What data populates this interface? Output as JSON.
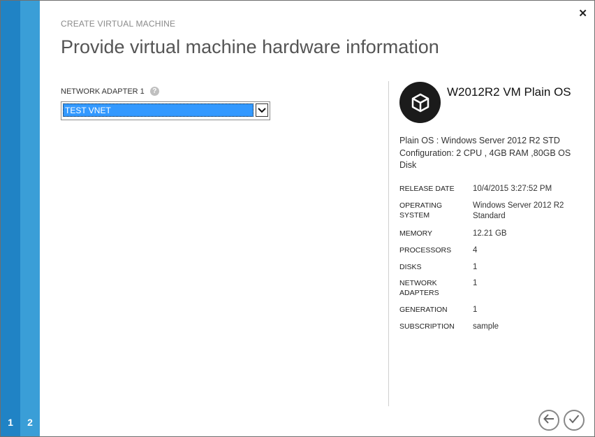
{
  "wizard": {
    "steps": [
      "1",
      "2"
    ],
    "kicker": "CREATE VIRTUAL MACHINE",
    "title": "Provide virtual machine hardware information",
    "close_label": "✕"
  },
  "form": {
    "network_adapter_label": "NETWORK ADAPTER 1",
    "help_icon": "?",
    "network_adapter_value": "TEST VNET"
  },
  "vm": {
    "name": "W2012R2 VM Plain OS",
    "description_line1": "Plain OS : Windows Server 2012 R2 STD",
    "description_line2": "Configuration: 2 CPU , 4GB RAM ,80GB OS Disk",
    "properties": [
      {
        "key": "RELEASE DATE",
        "value": "10/4/2015 3:27:52 PM"
      },
      {
        "key": "OPERATING SYSTEM",
        "value": "Windows Server 2012 R2 Standard"
      },
      {
        "key": "MEMORY",
        "value": "12.21 GB"
      },
      {
        "key": "PROCESSORS",
        "value": "4"
      },
      {
        "key": "DISKS",
        "value": "1"
      },
      {
        "key": "NETWORK ADAPTERS",
        "value": "1"
      },
      {
        "key": "GENERATION",
        "value": "1"
      },
      {
        "key": "SUBSCRIPTION",
        "value": "sample"
      }
    ]
  },
  "icons": {
    "vm": "cube-icon",
    "back": "arrow-left-icon",
    "finish": "checkmark-icon",
    "close": "close-icon",
    "dropdown": "chevron-down-icon"
  },
  "colors": {
    "step1": "#2083c5",
    "step2": "#3a9ed7",
    "selection": "#3399ff"
  }
}
